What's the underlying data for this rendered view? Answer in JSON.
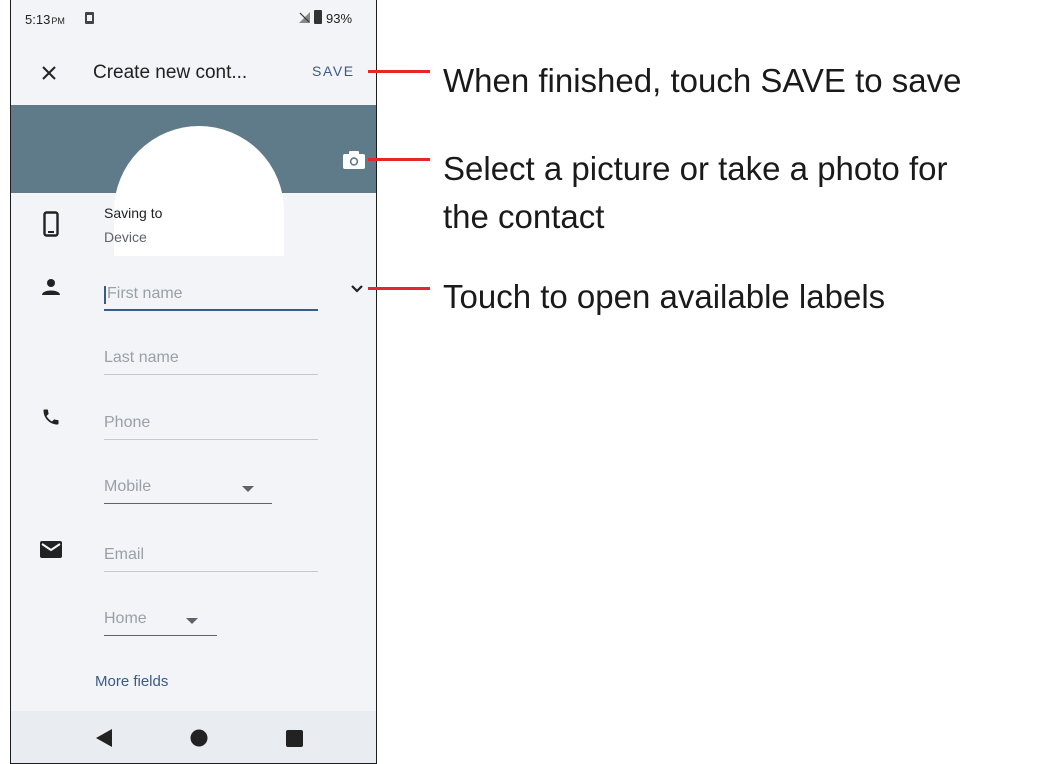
{
  "status_bar": {
    "time": "5:13",
    "ampm": "PM",
    "battery": "93%"
  },
  "app_bar": {
    "title": "Create new cont...",
    "save_label": "SAVE"
  },
  "form": {
    "saving_to_label": "Saving to",
    "saving_to_value": "Device",
    "first_name_placeholder": "First name",
    "last_name_placeholder": "Last name",
    "phone_placeholder": "Phone",
    "phone_type": "Mobile",
    "email_placeholder": "Email",
    "email_type": "Home",
    "more_fields": "More fields"
  },
  "annotations": {
    "save": "When finished, touch SAVE to save",
    "photo_line1": "Select a picture or take a photo for",
    "photo_line2": "the contact",
    "labels": "Touch to open available labels"
  },
  "colors": {
    "header": "#5f7a88",
    "accent": "#3b5a86",
    "callout": "#e5262a"
  },
  "icons": [
    "close-icon",
    "camera-icon",
    "phone-device-icon",
    "person-icon",
    "chevron-down-icon",
    "call-icon",
    "mail-icon",
    "back-icon",
    "home-icon",
    "recents-icon"
  ]
}
